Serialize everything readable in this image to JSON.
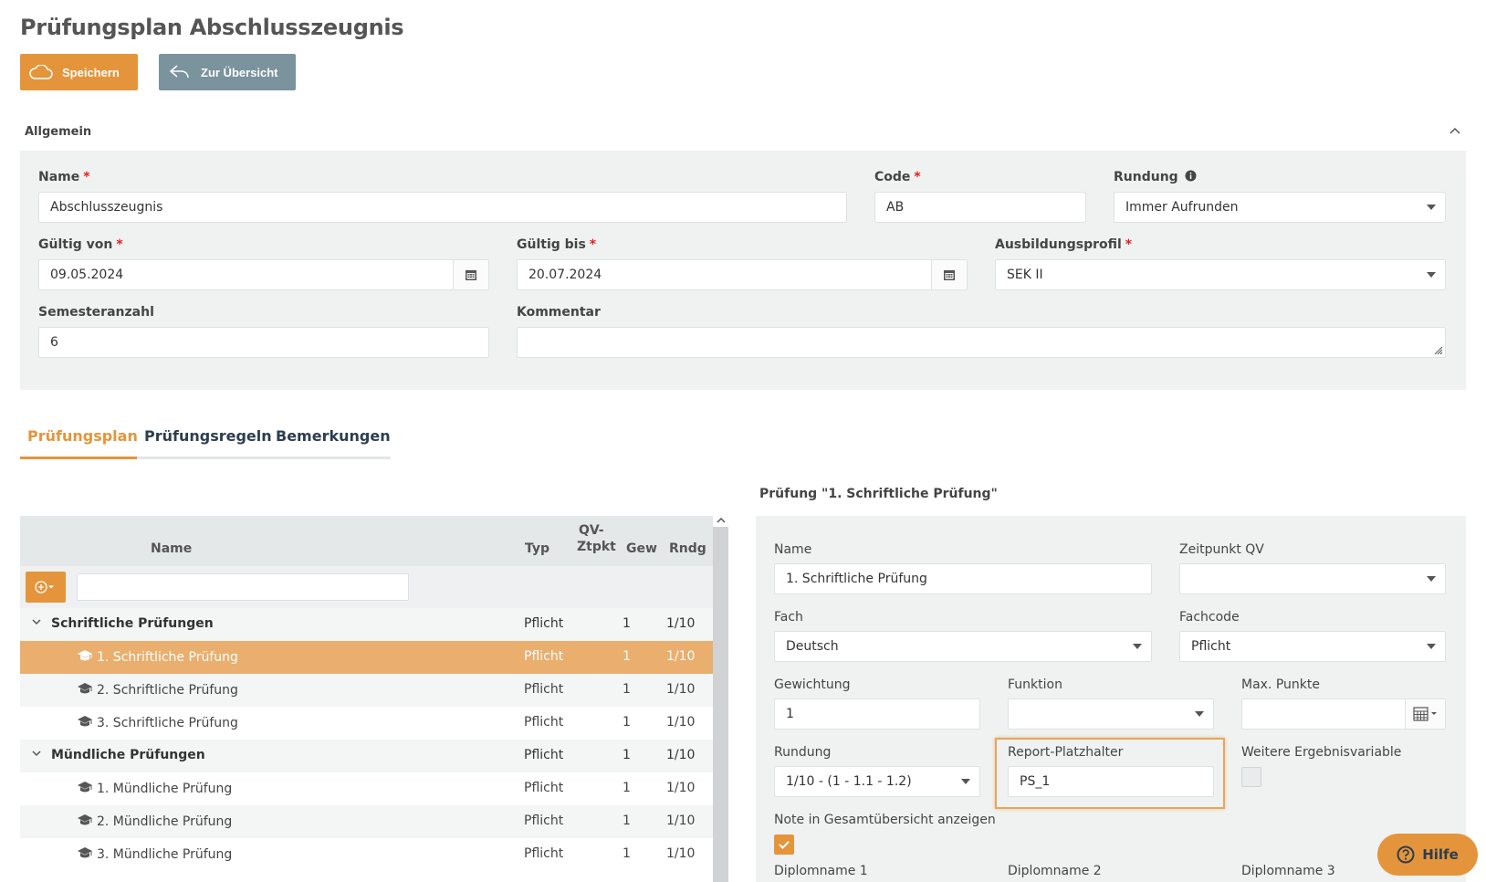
{
  "page": {
    "title": "Prüfungsplan Abschlusszeugnis"
  },
  "toolbar": {
    "save_label": "Speichern",
    "back_label": "Zur Übersicht"
  },
  "general": {
    "section_title": "Allgemein",
    "name_label": "Name",
    "name_value": "Abschlusszeugnis",
    "code_label": "Code",
    "code_value": "AB",
    "rundung_label": "Rundung",
    "rundung_value": "Immer Aufrunden",
    "gueltig_von_label": "Gültig von",
    "gueltig_von_value": "09.05.2024",
    "gueltig_bis_label": "Gültig bis",
    "gueltig_bis_value": "20.07.2024",
    "profil_label": "Ausbildungsprofil",
    "profil_value": "SEK II",
    "semester_label": "Semesteranzahl",
    "semester_value": "6",
    "kommentar_label": "Kommentar",
    "kommentar_value": ""
  },
  "tabs": [
    {
      "label": "Prüfungsplan",
      "active": true
    },
    {
      "label": "Prüfungsregeln",
      "active": false
    },
    {
      "label": "Bemerkungen",
      "active": false
    }
  ],
  "table": {
    "headers": {
      "name": "Name",
      "typ": "Typ",
      "qv1": "QV-",
      "qv2": "Ztpkt",
      "gew": "Gew",
      "rndg": "Rndg"
    },
    "filter_value": "",
    "rows": [
      {
        "name": "Schriftliche Prüfungen",
        "typ": "Pflicht",
        "gew": "1",
        "rndg": "1/10",
        "group": true
      },
      {
        "name": "1. Schriftliche Prüfung",
        "typ": "Pflicht",
        "gew": "1",
        "rndg": "1/10",
        "selected": true
      },
      {
        "name": "2. Schriftliche Prüfung",
        "typ": "Pflicht",
        "gew": "1",
        "rndg": "1/10"
      },
      {
        "name": "3. Schriftliche Prüfung",
        "typ": "Pflicht",
        "gew": "1",
        "rndg": "1/10"
      },
      {
        "name": "Mündliche Prüfungen",
        "typ": "Pflicht",
        "gew": "1",
        "rndg": "1/10",
        "group": true
      },
      {
        "name": "1. Mündliche Prüfung",
        "typ": "Pflicht",
        "gew": "1",
        "rndg": "1/10"
      },
      {
        "name": "2. Mündliche Prüfung",
        "typ": "Pflicht",
        "gew": "1",
        "rndg": "1/10"
      },
      {
        "name": "3. Mündliche Prüfung",
        "typ": "Pflicht",
        "gew": "1",
        "rndg": "1/10"
      }
    ]
  },
  "detail": {
    "title": "Prüfung \"1. Schriftliche Prüfung\"",
    "name_label": "Name",
    "name_value": "1. Schriftliche Prüfung",
    "zeitpunkt_label": "Zeitpunkt QV",
    "zeitpunkt_value": "",
    "fach_label": "Fach",
    "fach_value": "Deutsch",
    "fachcode_label": "Fachcode",
    "fachcode_value": "Pflicht",
    "gewichtung_label": "Gewichtung",
    "gewichtung_value": "1",
    "funktion_label": "Funktion",
    "funktion_value": "",
    "maxpunkte_label": "Max. Punkte",
    "maxpunkte_value": "",
    "rundung_label": "Rundung",
    "rundung_value": "1/10 - (1 - 1.1 - 1.2)",
    "report_label": "Report-Platzhalter",
    "report_value": "PS_1",
    "weitere_label": "Weitere Ergebnisvariable",
    "weitere_checked": false,
    "note_label": "Note in Gesamtübersicht anzeigen",
    "note_checked": true,
    "diplom1_label": "Diplomname 1",
    "diplom2_label": "Diplomname 2",
    "diplom3_label": "Diplomname 3"
  },
  "help": {
    "label": "Hilfe"
  },
  "colors": {
    "accent": "#e4953b",
    "secondary": "#7a939d",
    "selected_row": "#eaaf6e",
    "required": "#e02020"
  }
}
